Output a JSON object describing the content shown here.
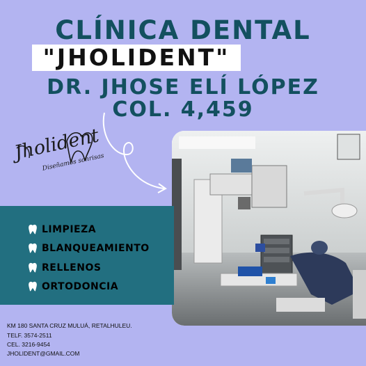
{
  "header": {
    "line1": "CLÍNICA DENTAL",
    "line2": "\"JHOLIDENT\"",
    "line3": "DR. JHOSE ELÍ LÓPEZ",
    "line4": "COL. 4,459"
  },
  "logo": {
    "name": "Jholident",
    "tagline": "Diseñamos sonrisas"
  },
  "services": [
    {
      "label": "LIMPIEZA",
      "icon": "tooth-icon"
    },
    {
      "label": "BLANQUEAMIENTO",
      "icon": "tooth-icon"
    },
    {
      "label": "RELLENOS",
      "icon": "tooth-icon"
    },
    {
      "label": "ORTODONCIA",
      "icon": "tooth-icon"
    }
  ],
  "contact": {
    "address": "KM 180 SANTA CRUZ MULUÁ, RETALHULEU.",
    "phone": "TELF. 3574-2511",
    "cell": "CEL. 3216-9454",
    "email": "JHOLIDENT@GMAIL.COM"
  },
  "colors": {
    "background": "#b3b4f1",
    "accent": "#13505f",
    "panel": "#226f80"
  }
}
